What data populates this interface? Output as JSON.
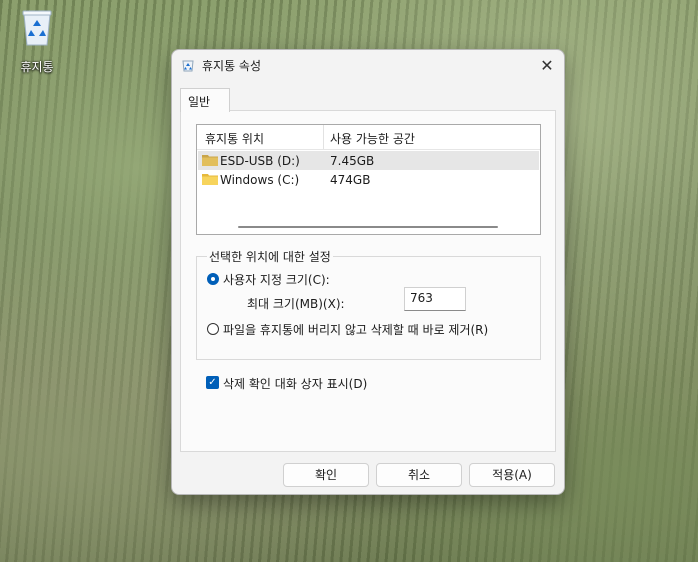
{
  "desktop": {
    "recycle_bin_label": "휴지통"
  },
  "dialog": {
    "title": "휴지통 속성",
    "close_glyph": "✕",
    "tab_general": "일반",
    "list": {
      "col_location": "휴지통 위치",
      "col_space": "사용 가능한 공간",
      "rows": [
        {
          "name": "ESD-USB (D:)",
          "space": "7.45GB",
          "selected": true
        },
        {
          "name": "Windows (C:)",
          "space": "474GB",
          "selected": false
        }
      ]
    },
    "settings": {
      "legend": "선택한 위치에 대한 설정",
      "custom_size_label": "사용자 지정 크기(C):",
      "max_size_label": "최대 크기(MB)(X):",
      "max_size_value": "763",
      "no_recycle_label": "파일을 휴지통에 버리지 않고 삭제할 때 바로 제거(R)",
      "selected_option": "custom_size"
    },
    "confirm_delete_label": "삭제 확인 대화 상자 표시(D)",
    "confirm_delete_checked": true,
    "buttons": {
      "ok": "확인",
      "cancel": "취소",
      "apply": "적용(A)"
    },
    "accent_color": "#005fb8"
  }
}
